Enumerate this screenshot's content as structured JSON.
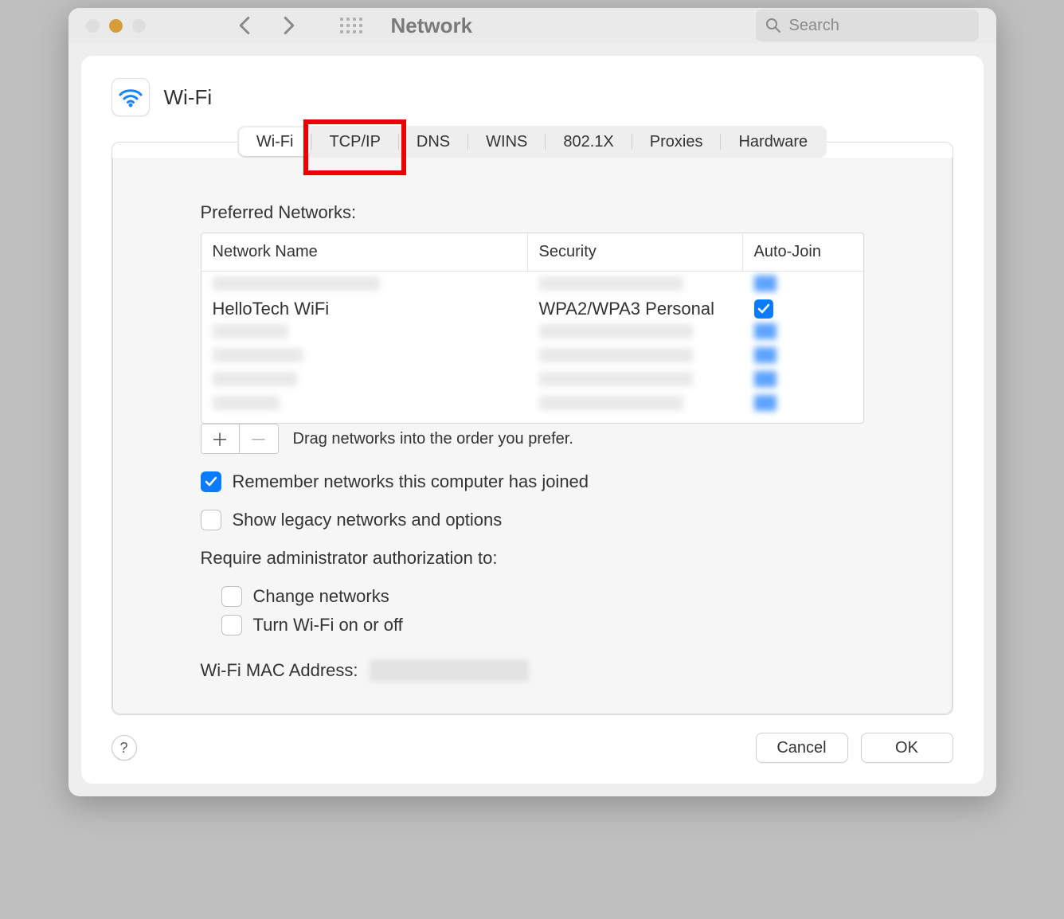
{
  "toolbar": {
    "title": "Network",
    "search_placeholder": "Search"
  },
  "panel": {
    "title": "Wi-Fi"
  },
  "tabs": [
    {
      "label": "Wi-Fi",
      "active": true
    },
    {
      "label": "TCP/IP",
      "highlighted": true
    },
    {
      "label": "DNS"
    },
    {
      "label": "WINS"
    },
    {
      "label": "802.1X"
    },
    {
      "label": "Proxies"
    },
    {
      "label": "Hardware"
    }
  ],
  "preferred_networks": {
    "label": "Preferred Networks:",
    "columns": {
      "name": "Network Name",
      "security": "Security",
      "autojoin": "Auto-Join"
    },
    "rows": [
      {
        "name": "",
        "security": "",
        "autojoin": true,
        "blurred": true
      },
      {
        "name": "HelloTech WiFi",
        "security": "WPA2/WPA3 Personal",
        "autojoin": true,
        "blurred": false
      },
      {
        "name": "",
        "security": "",
        "autojoin": true,
        "blurred": true
      },
      {
        "name": "",
        "security": "",
        "autojoin": true,
        "blurred": true
      },
      {
        "name": "",
        "security": "",
        "autojoin": true,
        "blurred": true
      },
      {
        "name": "",
        "security": "",
        "autojoin": true,
        "blurred": true
      }
    ],
    "hint": "Drag networks into the order you prefer."
  },
  "options": {
    "remember": {
      "label": "Remember networks this computer has joined",
      "checked": true
    },
    "legacy": {
      "label": "Show legacy networks and options",
      "checked": false
    },
    "require_label": "Require administrator authorization to:",
    "change_networks": {
      "label": "Change networks",
      "checked": false
    },
    "turn_wifi": {
      "label": "Turn Wi-Fi on or off",
      "checked": false
    }
  },
  "mac": {
    "label": "Wi-Fi MAC Address:"
  },
  "footer": {
    "cancel": "Cancel",
    "ok": "OK",
    "help": "?"
  }
}
